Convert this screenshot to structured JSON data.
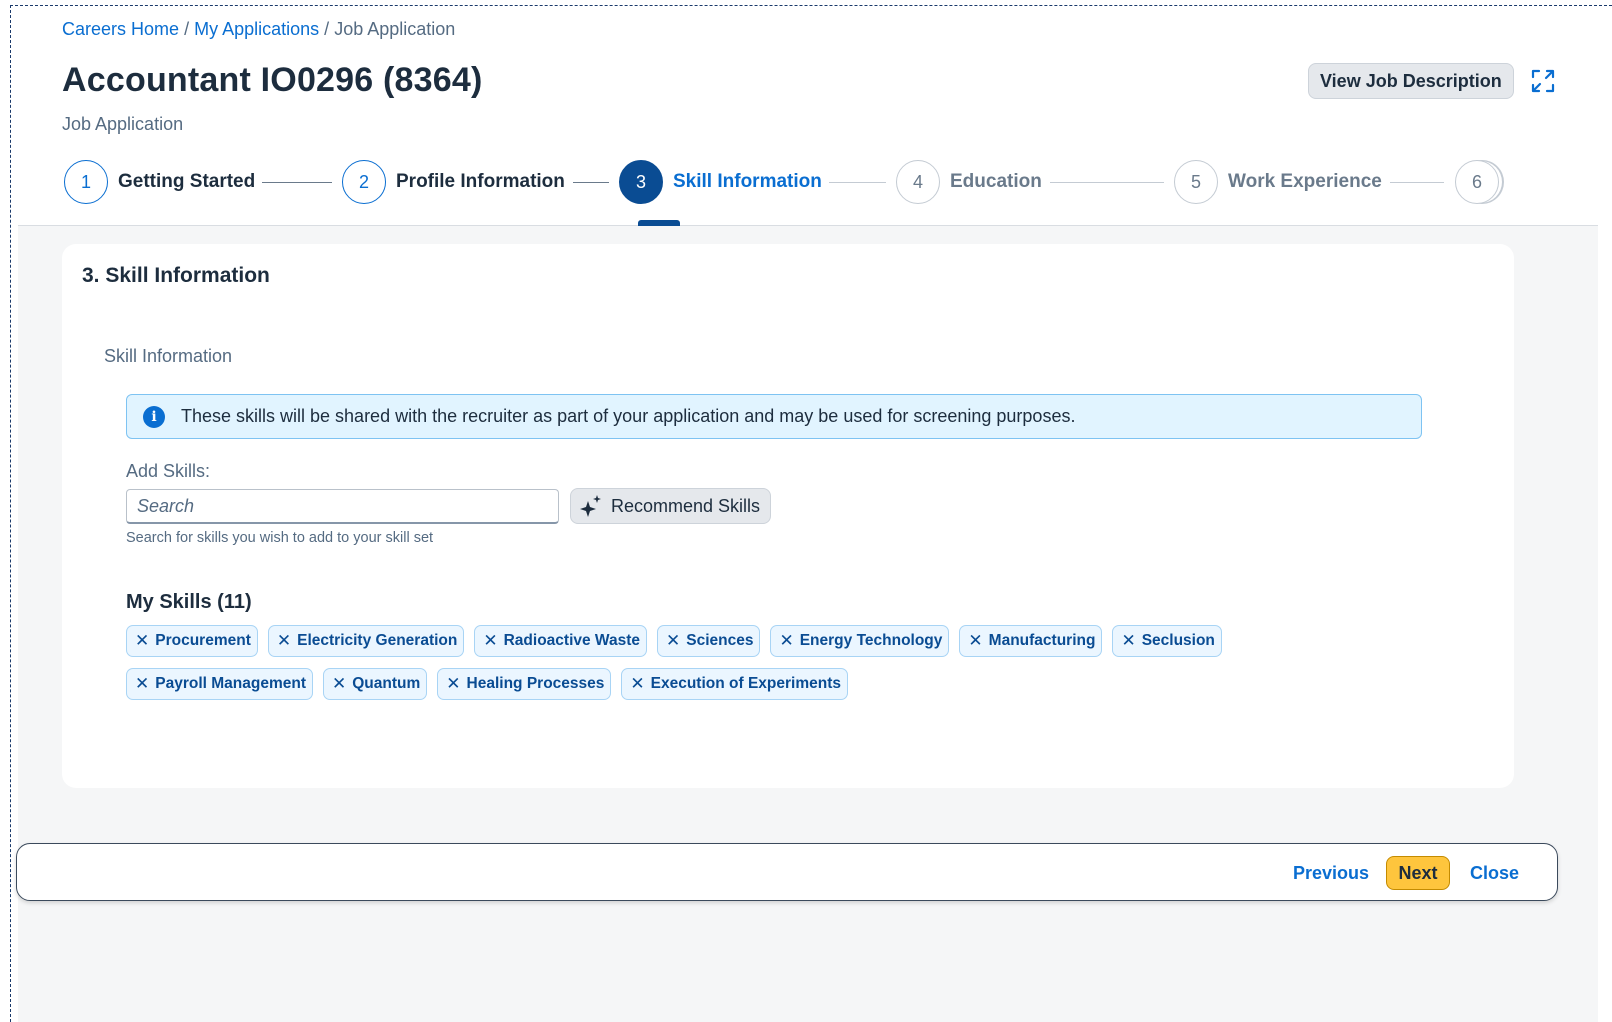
{
  "breadcrumb": {
    "home": "Careers Home",
    "sep1": "/",
    "applications": "My Applications",
    "sep2": "/",
    "current": "Job Application"
  },
  "header": {
    "title": "Accountant IO0296 (8364)",
    "subtitle": "Job Application",
    "view_jd_label": "View Job Description"
  },
  "steps": [
    {
      "number": "1",
      "label": "Getting Started",
      "state": "completed"
    },
    {
      "number": "2",
      "label": "Profile Information",
      "state": "completed"
    },
    {
      "number": "3",
      "label": "Skill Information",
      "state": "active"
    },
    {
      "number": "4",
      "label": "Education",
      "state": "future"
    },
    {
      "number": "5",
      "label": "Work Experience",
      "state": "future"
    },
    {
      "number": "6",
      "label": "",
      "state": "future"
    }
  ],
  "card": {
    "title": "3. Skill Information",
    "section_label": "Skill Information",
    "info_text": "These skills will be shared with the recruiter as part of your application and may be used for screening purposes.",
    "add_skills_label": "Add Skills:",
    "search_placeholder": "Search",
    "search_hint": "Search for skills you wish to add to your skill set",
    "recommend_label": "Recommend Skills",
    "my_skills_title": "My Skills (11)",
    "skills_row1": [
      "Procurement",
      "Electricity Generation",
      "Radioactive Waste",
      "Sciences",
      "Energy Technology",
      "Manufacturing",
      "Seclusion"
    ],
    "skills_row2": [
      "Payroll Management",
      "Quantum",
      "Healing Processes",
      "Execution of Experiments"
    ]
  },
  "footer": {
    "previous_label": "Previous",
    "next_label": "Next",
    "close_label": "Close"
  },
  "colors": {
    "accent": "#0a6ed1",
    "active_step": "#0a4c93",
    "next_button": "#fec53d",
    "info_bg": "#e1f4ff"
  }
}
